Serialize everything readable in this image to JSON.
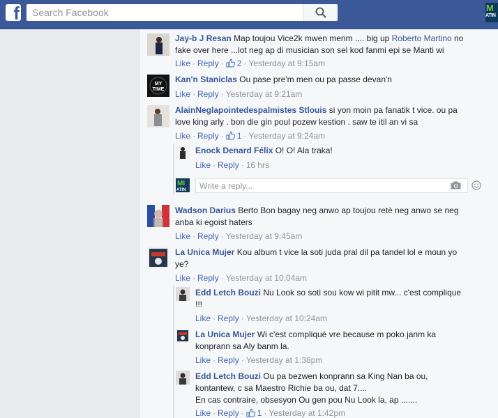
{
  "header": {
    "logo_letter": "f",
    "search_placeholder": "Search Facebook",
    "corner_logo_big": "M",
    "corner_logo_small": "ATIN"
  },
  "comments": [
    {
      "author": "Jay-b J Resan",
      "text_before": "Map toujou Vice2k mwen menm .... big up ",
      "mention": "Roberto Martino",
      "text_after": " no fake over here ...lot neg ap di musician son sel kod fanmi epi se Manti wi",
      "like": "Like",
      "reply": "Reply",
      "likes": "2",
      "time": "Yesterday at 9:15am"
    },
    {
      "author": "Kan'n Staniclas",
      "text": "Ou pase pre'm men ou pa passe devan'n",
      "avatar_text": "MY TIME",
      "like": "Like",
      "reply": "Reply",
      "time": "Yesterday at 9:21am"
    },
    {
      "author": "AlainNeglapointedespalmistes Stlouis",
      "text": "si yon moin pa fanatik t vice. ou pa love king arly . bon die gin poul pozew kestion . saw te itil an vi sa",
      "like": "Like",
      "reply": "Reply",
      "likes": "1",
      "time": "Yesterday at 9:24am"
    },
    {
      "author": "Enock Denard Félix",
      "text": "O! O! Ala traka!",
      "like": "Like",
      "reply": "Reply",
      "time": "16 hrs"
    },
    {
      "author": "Wadson Darius",
      "text": "Berto Bon bagay neg anwo ap toujou retè neg anwo se neg anba ki egoist haters",
      "like": "Like",
      "reply": "Reply",
      "time": "Yesterday at 9:45am"
    },
    {
      "author": "La Unica Mujer",
      "text": "Kou album t vice la soti juda pral dil pa tandel lol e moun yo ye?",
      "like": "Like",
      "reply": "Reply",
      "time": "Yesterday at 10:04am"
    },
    {
      "author": "Edd Letch Bouzi",
      "text": "Nu Look so soti sou kow wi pitit mw... c'est complique !!!",
      "like": "Like",
      "reply": "Reply",
      "time": "Yesterday at 10:24am"
    },
    {
      "author": "La Unica Mujer",
      "text": "Wi c'est compliqué vre because m poko janm ka konprann sa Aly banm la.",
      "like": "Like",
      "reply": "Reply",
      "time": "Yesterday at 1:38pm"
    },
    {
      "author": "Edd Letch Bouzi",
      "text": "Ou pa bezwen konprann sa King Nan ba ou, kontantew, c sa Maestro Richie ba ou, dat 7....",
      "text2": "En cas contraire, obsesyon Ou gen pou Nu Look la, ap .......",
      "like": "Like",
      "reply": "Reply",
      "likes": "1",
      "time": "Yesterday at 1:42pm"
    }
  ],
  "reply_box": {
    "placeholder": "Write a reply..."
  },
  "colors": {
    "brand": "#3b5998",
    "link": "#365899",
    "meta": "#90949c",
    "panel": "#f6f7f9"
  }
}
